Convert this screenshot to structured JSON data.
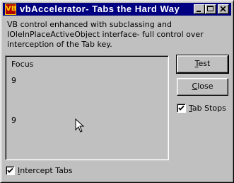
{
  "window": {
    "title": "vbAccelerator- Tabs the Hard Way",
    "icon": "vb-icon"
  },
  "titlebar_buttons": [
    "minimize-icon",
    "maximize-icon",
    "close-icon"
  ],
  "description": {
    "line1": "VB control enhanced with subclassing and",
    "line2": "IOleInPlaceActiveObject interface- full control over",
    "line3": "interception of the Tab key."
  },
  "panel": {
    "focus_label": "Focus",
    "value1": "9",
    "value2": "9"
  },
  "buttons": {
    "test": {
      "mnemonic": "T",
      "rest": "est"
    },
    "close": {
      "mnemonic": "C",
      "rest": "lose"
    }
  },
  "checkboxes": {
    "tab_stops": {
      "mnemonic": "T",
      "rest": "ab Stops",
      "checked": true
    },
    "intercept_tabs": {
      "mnemonic": "I",
      "rest": "ntercept Tabs",
      "checked": true
    }
  }
}
